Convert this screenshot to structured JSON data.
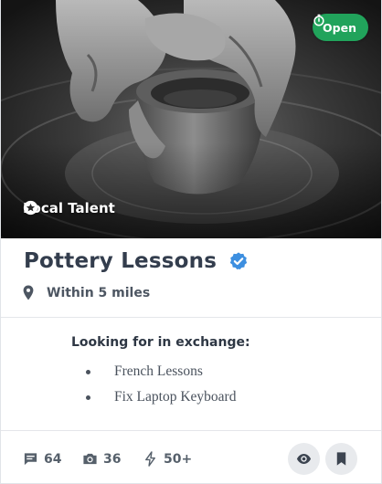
{
  "listing": {
    "status": "Open",
    "badge": "Local Talent",
    "title": "Pottery Lessons",
    "location": "Within 5 miles"
  },
  "exchange": {
    "heading": "Looking for in exchange:",
    "items": [
      "French Lessons",
      "Fix Laptop Keyboard"
    ]
  },
  "stats": {
    "comments": "64",
    "photos": "36",
    "boosts": "50+"
  },
  "icons": {
    "status": "stopwatch-icon",
    "badge": "star-circle-icon",
    "verified": "verified-check-icon",
    "location": "map-pin-icon",
    "comments": "chat-bubble-icon",
    "photos": "camera-icon",
    "boosts": "lightning-icon",
    "view": "eye-icon",
    "save": "bookmark-icon"
  },
  "colors": {
    "status_bg": "#21a35b",
    "verified": "#3d8fe0",
    "title": "#333d4d",
    "action_bg": "#e8eaed"
  }
}
